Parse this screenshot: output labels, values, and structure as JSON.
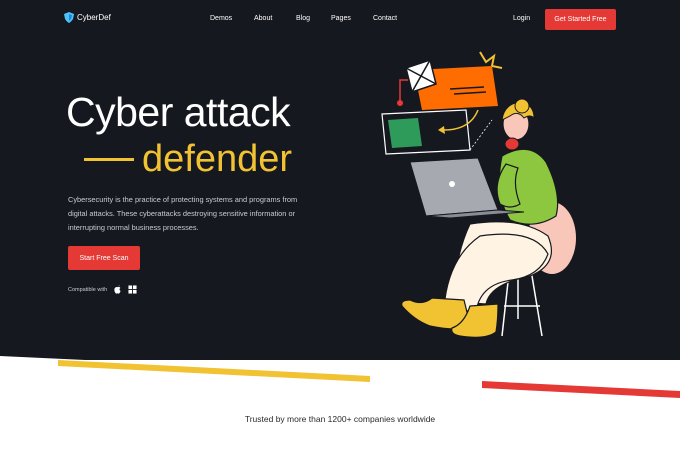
{
  "brand": {
    "name": "CyberDef"
  },
  "nav": {
    "links": [
      "Demos",
      "About",
      "Blog",
      "Pages",
      "Contact"
    ],
    "login_label": "Login",
    "cta_label": "Get Started Free"
  },
  "hero": {
    "title_line1": "Cyber attack",
    "title_line2": "defender",
    "description": "Cybersecurity is the practice of protecting systems and programs from digital attacks. These cyberattacks  destroying sensitive information or interrupting normal business processes.",
    "cta_label": "Start Free Scan",
    "compatible_label": "Compatible with",
    "compatible_platforms": [
      "apple-icon",
      "windows-icon"
    ]
  },
  "trusted": {
    "text": "Trusted by more than 1200+ companies worldwide"
  },
  "colors": {
    "background_dark": "#16181f",
    "accent_red": "#e53935",
    "accent_yellow": "#f1c232",
    "shirt_green": "#8dc63f",
    "envelope_orange": "#ff6d00"
  }
}
